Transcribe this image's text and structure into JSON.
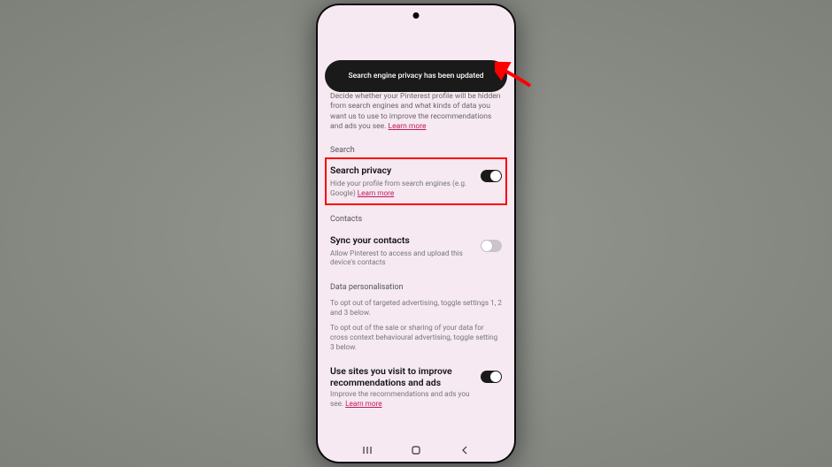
{
  "toast": "Search engine privacy has been updated",
  "intro_desc": "Decide whether your Pinterest profile will be hidden from search engines and what kinds of data you want us to use to improve the recommendations and ads you see. ",
  "learn_more": "Learn more",
  "sections": {
    "search": {
      "header": "Search",
      "item": {
        "title": "Search privacy",
        "sub_prefix": "Hide your profile from search engines (e.g. Google) "
      }
    },
    "contacts": {
      "header": "Contacts",
      "item": {
        "title": "Sync your contacts",
        "sub": "Allow Pinterest to access and upload this device's contacts"
      }
    },
    "data_pers": {
      "header": "Data personalisation",
      "para1": "To opt out of targeted advertising, toggle settings 1, 2 and 3 below.",
      "para2": "To opt out of the sale or sharing of your data for cross context behavioural advertising, toggle setting 3 below.",
      "item": {
        "title": "Use sites you visit to improve recommendations and ads",
        "sub_prefix": "Improve the recommendations and ads you see. "
      }
    }
  }
}
